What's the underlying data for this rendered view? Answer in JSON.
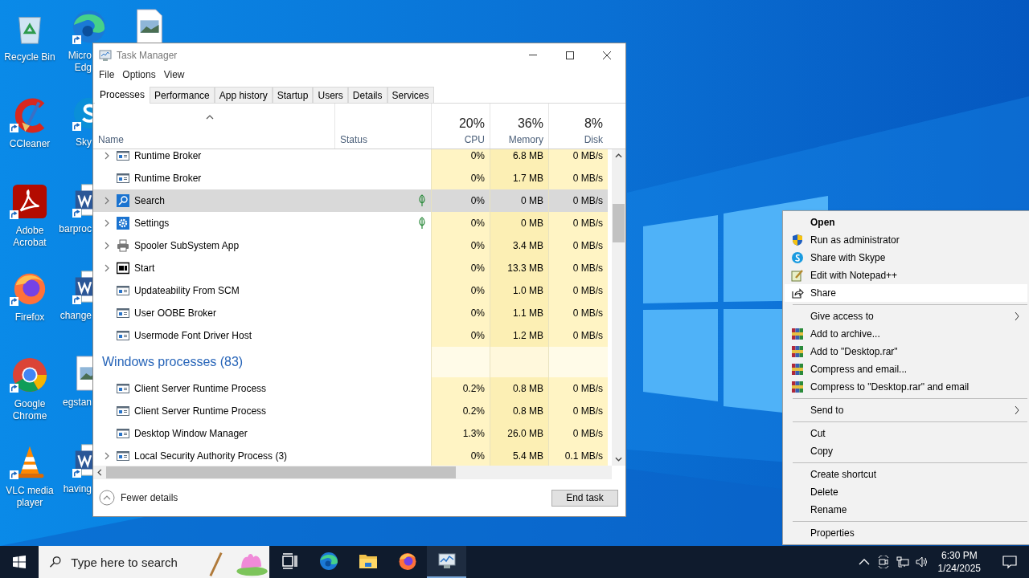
{
  "desktop": {
    "icons": [
      {
        "label": "Recycle Bin",
        "shortcut": false
      },
      {
        "label": "CCleaner",
        "shortcut": true
      },
      {
        "label": "Adobe Acrobat",
        "shortcut": true
      },
      {
        "label": "Firefox",
        "shortcut": true
      },
      {
        "label": "Google Chrome",
        "shortcut": true
      },
      {
        "label": "VLC media player",
        "shortcut": true
      }
    ],
    "covered_icons": [
      {
        "lines": [
          "Micro",
          "Edg"
        ],
        "shortcut": true
      },
      {
        "lines": [
          "Sky"
        ],
        "shortcut": true
      },
      {
        "lines": [
          "barproc"
        ],
        "shortcut": true
      },
      {
        "lines": [
          "change"
        ],
        "shortcut": true
      },
      {
        "lines": [
          "egstan"
        ],
        "shortcut": false
      },
      {
        "lines": [
          "having"
        ],
        "shortcut": true
      }
    ]
  },
  "window": {
    "title": "Task Manager",
    "menu": [
      "File",
      "Options",
      "View"
    ],
    "tabs": [
      {
        "label": "Processes",
        "selected": true
      },
      {
        "label": "Performance",
        "selected": false
      },
      {
        "label": "App history",
        "selected": false
      },
      {
        "label": "Startup",
        "selected": false
      },
      {
        "label": "Users",
        "selected": false
      },
      {
        "label": "Details",
        "selected": false
      },
      {
        "label": "Services",
        "selected": false
      }
    ],
    "columns": [
      {
        "name": "Name",
        "sorted": true
      },
      {
        "name": "Status",
        "sorted": false
      },
      {
        "percent": "20%",
        "name": "CPU",
        "sorted": false
      },
      {
        "percent": "36%",
        "name": "Memory",
        "sorted": false
      },
      {
        "percent": "8%",
        "name": "Disk",
        "sorted": false
      }
    ],
    "rows": [
      {
        "kind": "process",
        "name": "Runtime Broker",
        "expandable": true,
        "suspended": false,
        "selected": false,
        "cpu": "0%",
        "memory": "6.8 MB",
        "disk": "0 MB/s"
      },
      {
        "kind": "process",
        "name": "Runtime Broker",
        "expandable": false,
        "suspended": false,
        "selected": false,
        "cpu": "0%",
        "memory": "1.7 MB",
        "disk": "0 MB/s"
      },
      {
        "kind": "process",
        "name": "Search",
        "expandable": true,
        "suspended": true,
        "selected": true,
        "cpu": "0%",
        "memory": "0 MB",
        "disk": "0 MB/s"
      },
      {
        "kind": "process",
        "name": "Settings",
        "expandable": true,
        "suspended": true,
        "selected": false,
        "cpu": "0%",
        "memory": "0 MB",
        "disk": "0 MB/s"
      },
      {
        "kind": "process",
        "name": "Spooler SubSystem App",
        "expandable": true,
        "suspended": false,
        "selected": false,
        "cpu": "0%",
        "memory": "3.4 MB",
        "disk": "0 MB/s"
      },
      {
        "kind": "process",
        "name": "Start",
        "expandable": true,
        "suspended": false,
        "selected": false,
        "cpu": "0%",
        "memory": "13.3 MB",
        "disk": "0 MB/s"
      },
      {
        "kind": "process",
        "name": "Updateability From SCM",
        "expandable": false,
        "suspended": false,
        "selected": false,
        "cpu": "0%",
        "memory": "1.0 MB",
        "disk": "0 MB/s"
      },
      {
        "kind": "process",
        "name": "User OOBE Broker",
        "expandable": false,
        "suspended": false,
        "selected": false,
        "cpu": "0%",
        "memory": "1.1 MB",
        "disk": "0 MB/s"
      },
      {
        "kind": "process",
        "name": "Usermode Font Driver Host",
        "expandable": false,
        "suspended": false,
        "selected": false,
        "cpu": "0%",
        "memory": "1.2 MB",
        "disk": "0 MB/s"
      },
      {
        "kind": "group",
        "name": "Windows processes (83)"
      },
      {
        "kind": "process",
        "name": "Client Server Runtime Process",
        "expandable": false,
        "suspended": false,
        "selected": false,
        "cpu": "0.2%",
        "memory": "0.8 MB",
        "disk": "0 MB/s"
      },
      {
        "kind": "process",
        "name": "Client Server Runtime Process",
        "expandable": false,
        "suspended": false,
        "selected": false,
        "cpu": "0.2%",
        "memory": "0.8 MB",
        "disk": "0 MB/s"
      },
      {
        "kind": "process",
        "name": "Desktop Window Manager",
        "expandable": false,
        "suspended": false,
        "selected": false,
        "cpu": "1.3%",
        "memory": "26.0 MB",
        "disk": "0 MB/s"
      },
      {
        "kind": "process",
        "name": "Local Security Authority Process (3)",
        "expandable": true,
        "suspended": false,
        "selected": false,
        "cpu": "0%",
        "memory": "5.4 MB",
        "disk": "0.1 MB/s"
      }
    ],
    "fewer_details": "Fewer details",
    "end_task": "End task"
  },
  "context_menu": {
    "items": [
      {
        "kind": "item",
        "label": "Open",
        "default": true,
        "submenu": false,
        "selected": false
      },
      {
        "kind": "item",
        "label": "Run as administrator",
        "default": false,
        "submenu": false,
        "selected": false
      },
      {
        "kind": "item",
        "label": "Share with Skype",
        "default": false,
        "submenu": false,
        "selected": false
      },
      {
        "kind": "item",
        "label": "Edit with Notepad++",
        "default": false,
        "submenu": false,
        "selected": false
      },
      {
        "kind": "item",
        "label": "Share",
        "default": false,
        "submenu": false,
        "selected": true
      },
      {
        "kind": "separator"
      },
      {
        "kind": "item",
        "label": "Give access to",
        "default": false,
        "submenu": true,
        "selected": false
      },
      {
        "kind": "item",
        "label": "Add to archive...",
        "default": false,
        "submenu": false,
        "selected": false
      },
      {
        "kind": "item",
        "label": "Add to \"Desktop.rar\"",
        "default": false,
        "submenu": false,
        "selected": false
      },
      {
        "kind": "item",
        "label": "Compress and email...",
        "default": false,
        "submenu": false,
        "selected": false
      },
      {
        "kind": "item",
        "label": "Compress to \"Desktop.rar\" and email",
        "default": false,
        "submenu": false,
        "selected": false
      },
      {
        "kind": "separator"
      },
      {
        "kind": "item",
        "label": "Send to",
        "default": false,
        "submenu": true,
        "selected": false
      },
      {
        "kind": "separator"
      },
      {
        "kind": "item",
        "label": "Cut",
        "default": false,
        "submenu": false,
        "selected": false
      },
      {
        "kind": "item",
        "label": "Copy",
        "default": false,
        "submenu": false,
        "selected": false
      },
      {
        "kind": "separator"
      },
      {
        "kind": "item",
        "label": "Create shortcut",
        "default": false,
        "submenu": false,
        "selected": false
      },
      {
        "kind": "item",
        "label": "Delete",
        "default": false,
        "submenu": false,
        "selected": false
      },
      {
        "kind": "item",
        "label": "Rename",
        "default": false,
        "submenu": false,
        "selected": false
      },
      {
        "kind": "separator"
      },
      {
        "kind": "item",
        "label": "Properties",
        "default": false,
        "submenu": false,
        "selected": false
      }
    ]
  },
  "taskbar": {
    "search": {
      "placeholder": "Type here to search"
    },
    "apps": [
      {
        "running": false
      },
      {
        "running": false
      },
      {
        "running": false
      },
      {
        "running": true
      }
    ],
    "clock": {
      "time": "6:30 PM",
      "date": "1/24/2025"
    }
  }
}
